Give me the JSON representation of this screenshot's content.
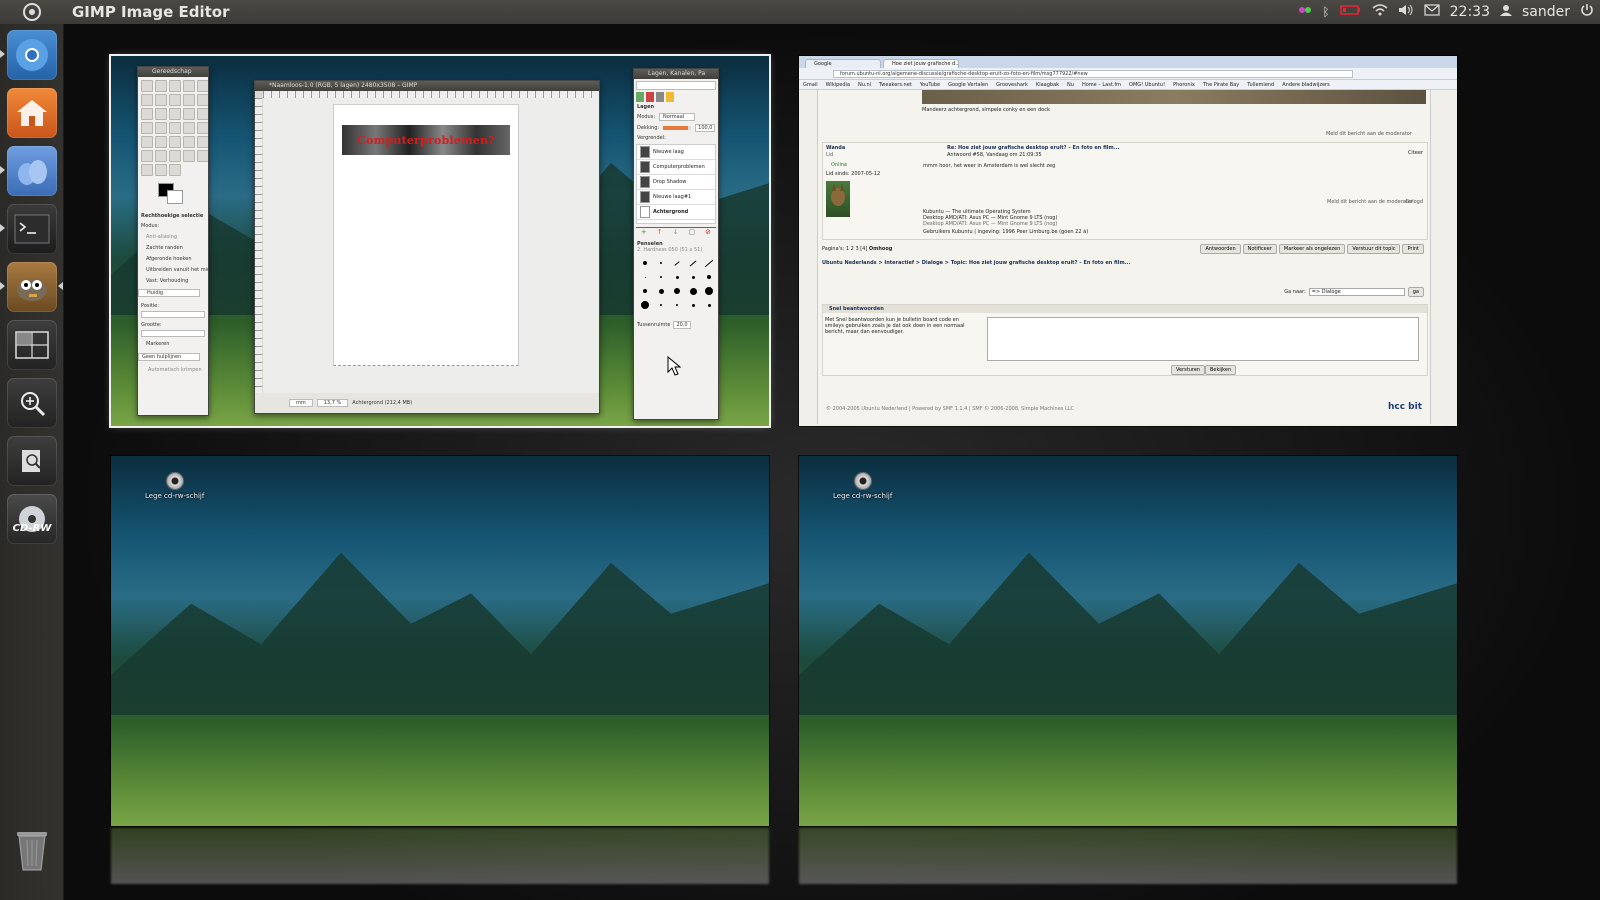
{
  "topbar": {
    "app_title": "GIMP Image Editor",
    "clock": "22:33",
    "user": "sander",
    "tray_icons": [
      "indicator-icon",
      "bluetooth-icon",
      "battery-icon",
      "wifi-icon",
      "volume-icon",
      "mail-icon"
    ]
  },
  "launcher": {
    "items": [
      "chromium",
      "home-folder",
      "empathy",
      "terminal",
      "gimp",
      "workspace-switcher",
      "magnifier",
      "search-files",
      "cd-rw"
    ],
    "cd_label": "CD-RW"
  },
  "workspaces": {
    "ws1": {
      "gimp_toolbox_title": "Gereedschap",
      "gimp_tool_options_title": "Rechthoekige selectie",
      "gimp_tool_options": [
        "Modus:",
        "Anti-aliasing",
        "Zachte randen",
        "Afgeronde hoeken",
        "Uitbreiden vanuit het midden",
        "Vast: Verhouding",
        "Huidig",
        "Positie:",
        "Grootte:",
        "Markeren",
        "Geen hulplijnen",
        "Automatisch krimpen"
      ],
      "gimp_canvas_title": "*Naamloos-1.0 (RGB, 5 lagen) 2480x3508 – GIMP",
      "gimp_banner_text": "Computerproblemen?",
      "gimp_status": "Achtergrond (212,4 MB)",
      "gimp_zoom": "13,7 %",
      "gimp_unit": "mm",
      "layers_title": "Lagen, Kanalen, Pa",
      "layers_section": "Lagen",
      "layers_mode_label": "Modus:",
      "layers_mode": "Normaal",
      "layers_opacity_label": "Dekking:",
      "layers_opacity": "100,0",
      "layers_lock_label": "Vergrendel:",
      "layers": [
        "Nieuwe laag",
        "Computerproblemen",
        "Drop Shadow",
        "Nieuwe laag#1",
        "Achtergrond"
      ],
      "brushes_title": "Penselen",
      "brushes_sub": "2. Hardness 050 (51 x 51)",
      "brushes_spacing_label": "Tussenruimte",
      "brushes_spacing": "20,0"
    },
    "ws2": {
      "tabs": [
        "Google",
        "Hoe ziet jouw grafische d..."
      ],
      "url": "forum.ubuntu-nl.org/algemene-discussie/grafische-desktop-eruit-zo-foto-en-film/msg777922/#new",
      "bookmarks": [
        "Gmail",
        "Wikipedia",
        "Nu.nl",
        "Tweakers.net",
        "YouTube",
        "Google Vertalen",
        "Grooveshark",
        "Klaagbak",
        "Nu",
        "Home – Last.fm",
        "OMG! Ubuntu!",
        "Phoronix",
        "The Pirate Bay",
        "Tullemiend",
        "Andere bladwijzers"
      ],
      "post1_caption": "Mandeerz achtergrond, simpele conky en een dock",
      "report_link": "Meld dit bericht aan de moderator",
      "ip_label": "Gelogd",
      "author": "Wanda",
      "author_role": "Lid",
      "online_label": "Online",
      "member_since": "Lid sinds: 2007-05-12",
      "post2_title": "Re: Hoe ziet jouw grafische desktop eruit? – En foto en film...",
      "post2_meta": "Antwoord #58, Vandaag om 21:09:35",
      "quote_label": "Citeer",
      "post2_body": "mmm hoor, het weer in Amsterdam is wel slecht zeg",
      "signature": [
        "Kubuntu — The ultimate Operating System",
        "Desktop AMD/ATI: Asus PC — Mint Gnome 9 LTS (nog)",
        "Desktop AMD/ATI: Asus PC — Mint Gnome 9 LTS (nog)",
        "Gebruikers Kubuntu | ingeving: 1996 Peer Limburg.be (goen 22 à)"
      ],
      "pages": "Pagina's: 1 2 3 [4]",
      "pages_link": "Omhoog",
      "action_buttons": [
        "Antwoorden",
        "Notificeer",
        "Markeer als ongelezen",
        "Verstuur dit topic",
        "Print"
      ],
      "breadcrumb": [
        "Ubuntu Nederlands",
        "Interactief",
        "Dialoge",
        "Topic: Hoe ziet jouw grafische desktop eruit? – En foto en film..."
      ],
      "jump_label": "Ga naar:",
      "jump_value": "=> Dialoge",
      "jump_go": "ga",
      "quick_reply_title": "Snel beantwoorden",
      "quick_reply_text": "Met Snel beantwoorden kun je bulletin board code en smileys gebruiken zoals je dat ook doen in een normaal bericht, maar dan eenvoudiger.",
      "send_button": "Versturen",
      "preview_button": "Bekijken",
      "footer": "© 2004-2005 Ubuntu Nederland | Powered by SMF 1.1.4 | SMF © 2006-2008, Simple Machines LLC",
      "footer_logo": "hcc bit"
    },
    "ws3": {
      "desktop_icon_label": "Lege cd-rw-schijf"
    },
    "ws4": {
      "desktop_icon_label": "Lege cd-rw-schijf"
    }
  }
}
